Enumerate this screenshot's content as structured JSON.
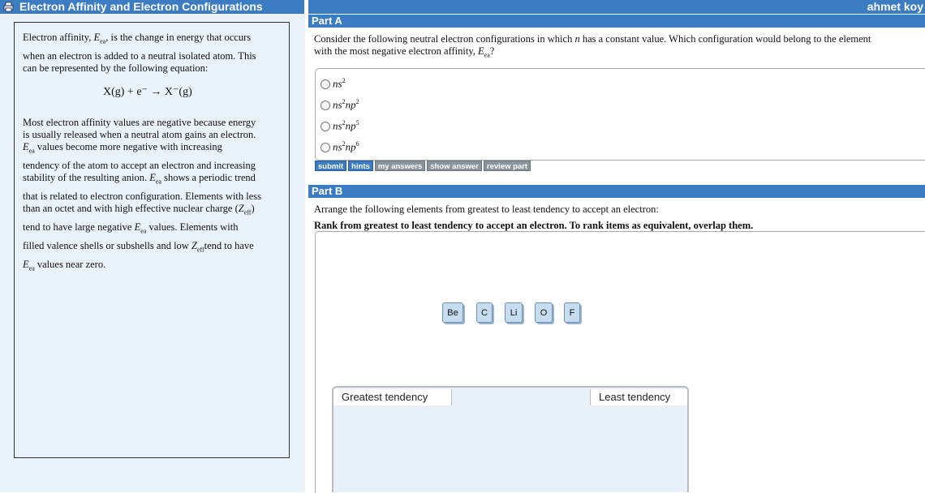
{
  "header": {
    "title": "Electron Affinity and Electron Configurations",
    "user": "ahmet koy"
  },
  "info": {
    "p1_a": "Electron affinity,",
    "ea_sym": "E",
    "ea_sub": "ea",
    "p1_b": ", is the change in energy that occurs",
    "p1_c": "when an electron is added to a neutral isolated atom. This",
    "p1_d": "can be represented by the following equation:",
    "equation": "X(g) + e⁻ → X⁻(g)",
    "p2_a": "Most electron affinity values are negative because energy",
    "p2_b": "is usually released when a neutral atom gains an electron.",
    "p2_c": " values become more negative with increasing",
    "p2_d": "tendency of the atom to accept an electron and increasing",
    "p2_e": "stability of the resulting anion.",
    "p2_f": " shows a periodic trend",
    "p2_g": "that is related to electron configuration. Elements with less",
    "p2_h": "than an octet and with high effective nuclear charge (",
    "zeff_sym": "Z",
    "zeff_sub": "eff",
    "p2_i": ")",
    "p2_j": "tend to have large negative",
    "p2_k": " values. Elements with",
    "p2_l": "filled valence shells or subshells and low",
    "p2_m": "tend to have",
    "p2_n": " values near zero."
  },
  "partA": {
    "label": "Part A",
    "q1": "Consider the following neutral electron configurations in which ",
    "n": "n",
    "q2": " has a constant value. Which configuration would belong to the element",
    "q3": "with the most negative electron affinity, ",
    "q4": "?",
    "options": [
      {
        "a": "ns",
        "a_sup": "2",
        "b": "",
        "b_sup": ""
      },
      {
        "a": "ns",
        "a_sup": "2",
        "b": "np",
        "b_sup": "2"
      },
      {
        "a": "ns",
        "a_sup": "2",
        "b": "np",
        "b_sup": "5"
      },
      {
        "a": "ns",
        "a_sup": "2",
        "b": "np",
        "b_sup": "6"
      }
    ],
    "buttons": {
      "submit": "submit",
      "hints": "hints",
      "my_answers": "my answers",
      "show_answer": "show answer",
      "review_part": "review part"
    }
  },
  "partB": {
    "label": "Part B",
    "instruction": "Arrange the following elements from greatest to least tendency to accept an electron:",
    "rank_instruction": "Rank from greatest to least tendency to accept an electron. To rank items as equivalent, overlap them.",
    "tiles": [
      "Be",
      "C",
      "Li",
      "O",
      "F"
    ],
    "greatest_label": "Greatest tendency",
    "least_label": "Least tendency"
  },
  "colors": {
    "header_blue": "#3c7cc2",
    "panel_bg": "#eaf2fb",
    "tile_bg": "#c6dcef"
  }
}
